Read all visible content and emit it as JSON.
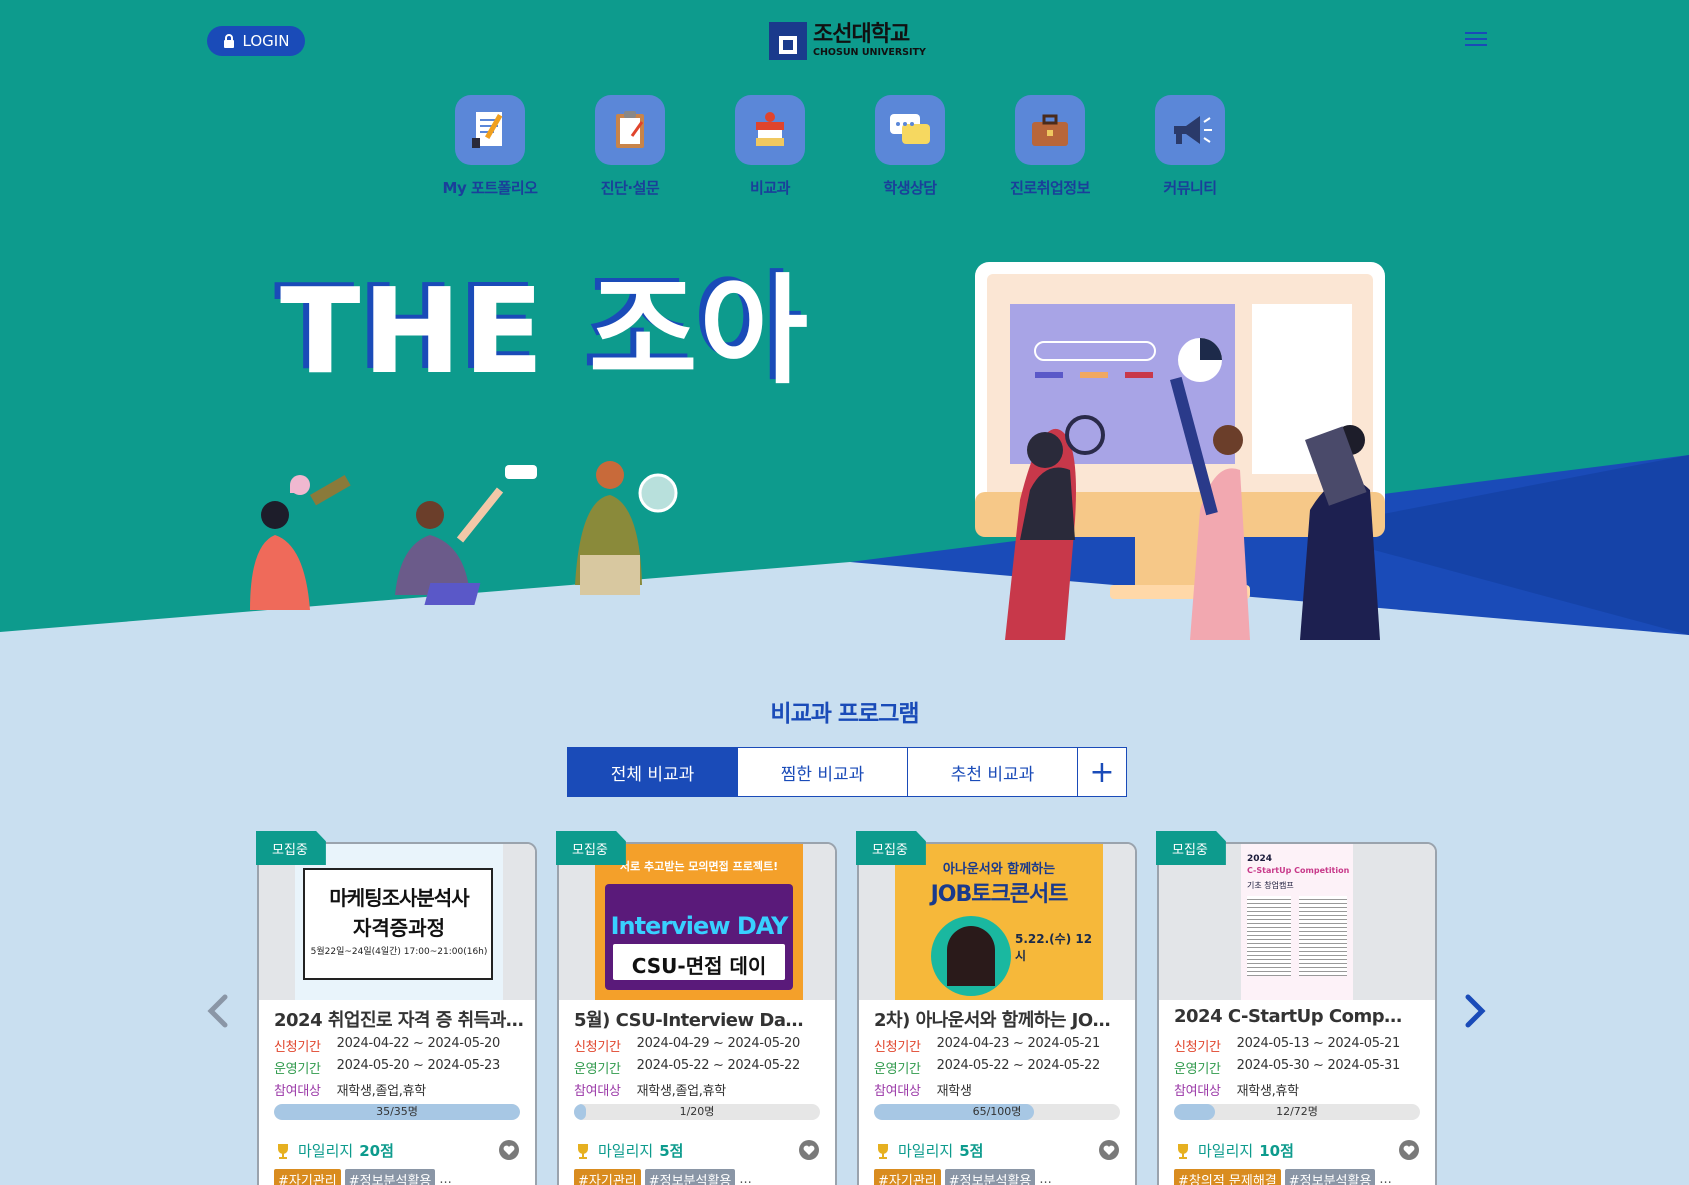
{
  "header": {
    "login_label": "LOGIN",
    "logo_kr": "조선대학교",
    "logo_en": "CHOSUN UNIVERSITY"
  },
  "quick_nav": [
    {
      "label": "My 포트폴리오",
      "icon": "document-pen-icon"
    },
    {
      "label": "진단·설문",
      "icon": "clipboard-icon"
    },
    {
      "label": "비교과",
      "icon": "books-icon"
    },
    {
      "label": "학생상담",
      "icon": "chat-bubble-icon"
    },
    {
      "label": "진로취업정보",
      "icon": "briefcase-icon"
    },
    {
      "label": "커뮤니티",
      "icon": "megaphone-icon"
    }
  ],
  "hero": {
    "title": "THE 조아"
  },
  "section": {
    "title": "비교과 프로그램"
  },
  "tabs": [
    {
      "label": "전체 비교과",
      "active": true
    },
    {
      "label": "찜한 비교과",
      "active": false
    },
    {
      "label": "추천 비교과",
      "active": false
    }
  ],
  "tab_more": "+",
  "labels": {
    "apply": "신청기간",
    "run": "운영기간",
    "target": "참여대상",
    "mileage": "마일리지"
  },
  "cards": [
    {
      "badge": "모집중",
      "title": "2024 취업진로 자격 증 취득과…",
      "apply_period": "2024-04-22 ~ 2024-05-20",
      "run_period": "2024-05-20 ~ 2024-05-23",
      "target": "재학생,졸업,휴학",
      "capacity": "35/35명",
      "fill_fraction": 1.0,
      "mileage": "20점",
      "tags": [
        "#자기관리",
        "#정보분석활용"
      ],
      "more": "...",
      "poster": {
        "line1": "마케팅조사분석사",
        "line2": "자격증과정",
        "line3": "5월22일~24일(4일간) 17:00~21:00(16h)"
      }
    },
    {
      "badge": "모집중",
      "title": "5월) CSU-Interview Da…",
      "apply_period": "2024-04-29 ~ 2024-05-20",
      "run_period": "2024-05-22 ~ 2024-05-22",
      "target": "재학생,졸업,휴학",
      "capacity": "1/20명",
      "fill_fraction": 0.05,
      "mileage": "5점",
      "tags": [
        "#자기관리",
        "#정보분석활용"
      ],
      "more": "...",
      "poster": {
        "line1": "서로 추고받는 모의면접 프로젝트!",
        "line2": "Interview DAY",
        "line3": "CSU-면접 데이"
      }
    },
    {
      "badge": "모집중",
      "title": "2차) 아나운서와 함께하는 JO…",
      "apply_period": "2024-04-23 ~ 2024-05-21",
      "run_period": "2024-05-22 ~ 2024-05-22",
      "target": "재학생",
      "capacity": "65/100명",
      "fill_fraction": 0.65,
      "mileage": "5점",
      "tags": [
        "#자기관리",
        "#정보분석활용"
      ],
      "more": "...",
      "poster": {
        "line1": "아나운서와 함께하는",
        "line2": "JOB토크콘서트",
        "line3": "5.22.(수) 12시"
      }
    },
    {
      "badge": "모집중",
      "title": "2024 C-StartUp Comp…",
      "apply_period": "2024-05-13 ~ 2024-05-21",
      "run_period": "2024-05-30 ~ 2024-05-31",
      "target": "재학생,휴학",
      "capacity": "12/72명",
      "fill_fraction": 0.167,
      "mileage": "10점",
      "tags": [
        "#창의적 문제해결",
        "#정보분석활용"
      ],
      "more": "...",
      "poster": {
        "line1": "2024",
        "line2": "C-StartUp Competition",
        "line3": "기초 창업캠프"
      }
    }
  ]
}
